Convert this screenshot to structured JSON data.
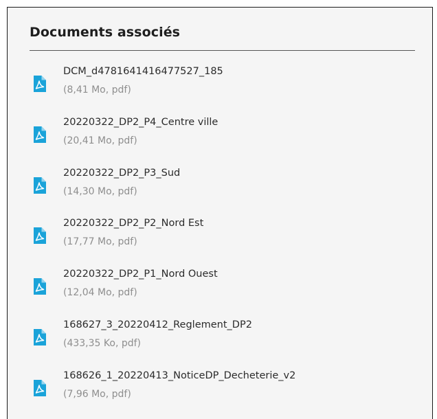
{
  "section": {
    "title": "Documents associés",
    "icon_color": "#1aa3d9"
  },
  "documents": [
    {
      "name": "DCM_d4781641416477527_185",
      "meta": "(8,41 Mo, pdf)",
      "icon": "pdf-file-icon"
    },
    {
      "name": "20220322_DP2_P4_Centre ville",
      "meta": "(20,41 Mo, pdf)",
      "icon": "pdf-file-icon"
    },
    {
      "name": "20220322_DP2_P3_Sud",
      "meta": "(14,30 Mo, pdf)",
      "icon": "pdf-file-icon"
    },
    {
      "name": "20220322_DP2_P2_Nord Est",
      "meta": "(17,77 Mo, pdf)",
      "icon": "pdf-file-icon"
    },
    {
      "name": "20220322_DP2_P1_Nord Ouest",
      "meta": "(12,04 Mo, pdf)",
      "icon": "pdf-file-icon"
    },
    {
      "name": "168627_3_20220412_Reglement_DP2",
      "meta": "(433,35 Ko, pdf)",
      "icon": "pdf-file-icon"
    },
    {
      "name": "168626_1_20220413_NoticeDP_Decheterie_v2",
      "meta": "(7,96 Mo, pdf)",
      "icon": "pdf-file-icon"
    }
  ]
}
